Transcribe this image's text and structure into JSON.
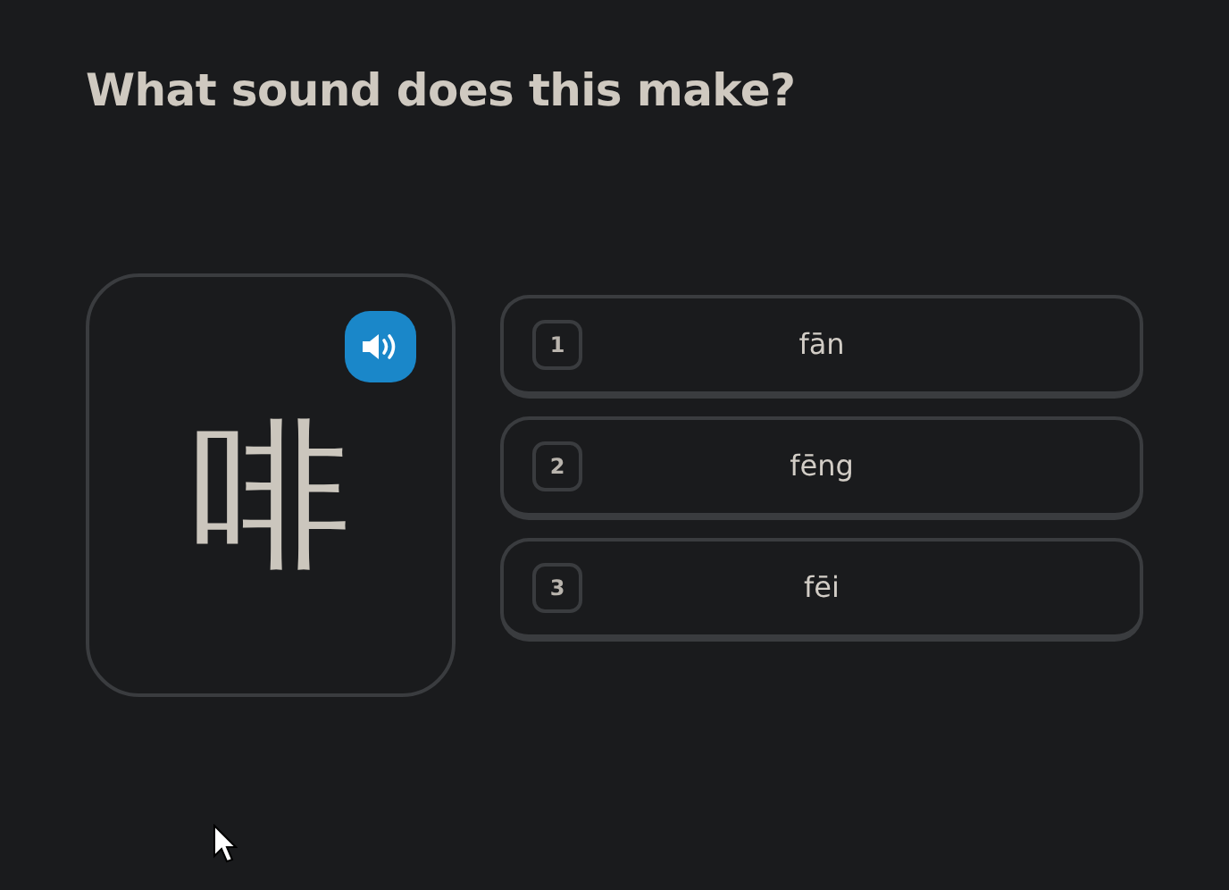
{
  "question": "What sound does this make?",
  "prompt": {
    "character": "啡"
  },
  "options": [
    {
      "number": "1",
      "text": "fān"
    },
    {
      "number": "2",
      "text": "fēng"
    },
    {
      "number": "3",
      "text": "fēi"
    }
  ]
}
